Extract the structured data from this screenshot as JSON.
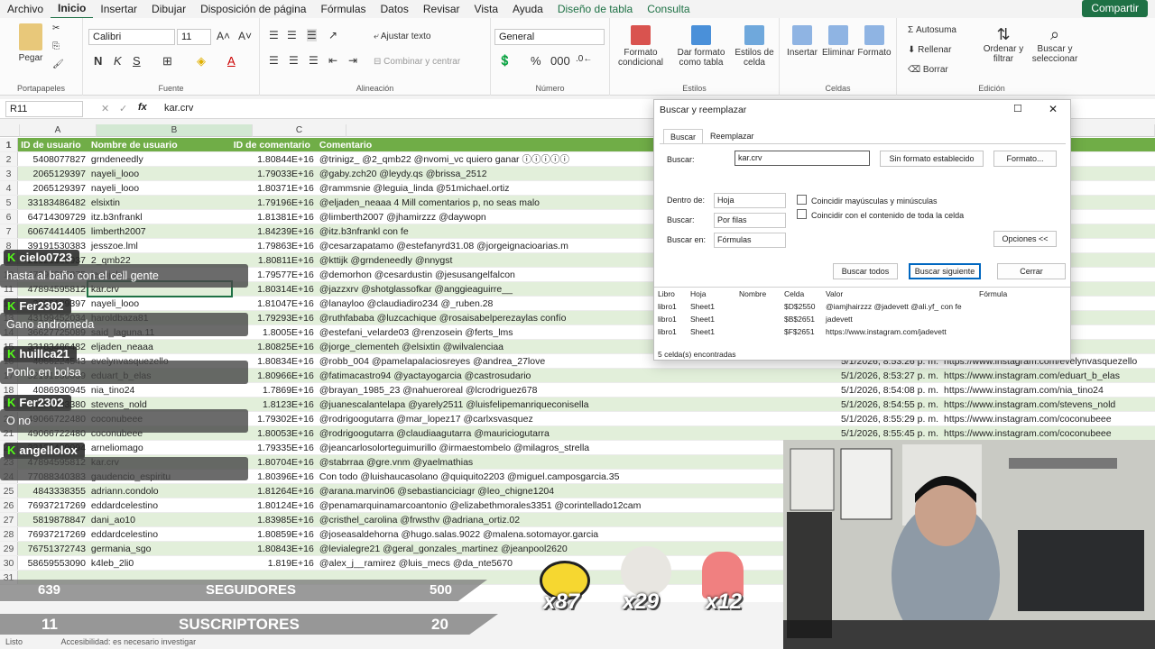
{
  "menu": {
    "tabs": [
      "Archivo",
      "Inicio",
      "Insertar",
      "Dibujar",
      "Disposición de página",
      "Fórmulas",
      "Datos",
      "Revisar",
      "Vista",
      "Ayuda",
      "Diseño de tabla",
      "Consulta"
    ],
    "share": "Compartir"
  },
  "ribbon": {
    "paste": "Pegar",
    "clipboard": "Portapapeles",
    "font_name": "Calibri",
    "font_size": "11",
    "font_group": "Fuente",
    "wrap": "Ajustar texto",
    "merge": "Combinar y centrar",
    "align_group": "Alineación",
    "number_format": "General",
    "number_group": "Número",
    "cond_format": "Formato condicional",
    "table_format": "Dar formato como tabla",
    "cell_styles": "Estilos de celda",
    "styles_group": "Estilos",
    "insert": "Insertar",
    "delete": "Eliminar",
    "format": "Formato",
    "cells_group": "Celdas",
    "autosum": "Autosuma",
    "fill": "Rellenar",
    "clear": "Borrar",
    "sort": "Ordenar y filtrar",
    "find": "Buscar y seleccionar",
    "edit_group": "Edición"
  },
  "formula_bar": {
    "cell_ref": "R11",
    "fx": "fx",
    "value": "kar.crv"
  },
  "columns": [
    "A",
    "B",
    "C",
    "D"
  ],
  "table": {
    "headers": [
      "ID de usuario",
      "Nombre de usuario",
      "ID de comentario",
      "Comentario"
    ],
    "rows": [
      {
        "n": "2",
        "a": "5408077827",
        "b": "grndeneedly",
        "c": "1.80844E+16",
        "d": "@trinigz_ @2_qmb22 @nvomi_vc quiero ganar ⓘⓘⓘⓘⓘ",
        "e": "",
        "f": "eedly"
      },
      {
        "n": "3",
        "a": "2065129397",
        "b": "nayeli_looo",
        "c": "1.79033E+16",
        "d": "@gaby.zch20 @leydy.qs @brissa_2512",
        "e": "",
        "f": ""
      },
      {
        "n": "4",
        "a": "2065129397",
        "b": "nayeli_looo",
        "c": "1.80371E+16",
        "d": "@rammsnie @leguia_linda @51michael.ortiz",
        "e": "",
        "f": ""
      },
      {
        "n": "5",
        "a": "33183486482",
        "b": "elsixtin",
        "c": "1.79196E+16",
        "d": "@eljaden_neaaa 4 Mill comentarios p, no seas malo",
        "e": "",
        "f": ""
      },
      {
        "n": "6",
        "a": "64714309729",
        "b": "itz.b3nfrankl",
        "c": "1.81381E+16",
        "d": "@limberth2007 @jhamirzzz @daywopn",
        "e": "",
        "f": "frankl"
      },
      {
        "n": "7",
        "a": "60674414405",
        "b": "limberth2007",
        "c": "1.84239E+16",
        "d": "@itz.b3nfrankl con fe",
        "e": "",
        "f": "th2007"
      },
      {
        "n": "8",
        "a": "39191530383",
        "b": "jesszoe.lml",
        "c": "1.79863E+16",
        "d": "@cesarzapatamo @estefanyrd31.08 @jorgeignacioarias.m",
        "e": "",
        "f": "e.lml"
      },
      {
        "n": "9",
        "a": "26121339937",
        "b": "2_qmb22",
        "c": "1.80811E+16",
        "d": "@kttijk @grndeneedly @nnygst",
        "e": "",
        "f": ""
      },
      {
        "n": "10",
        "a": "47895395875",
        "b": "jesujohn_",
        "c": "1.79577E+16",
        "d": "@demorhon @cesardustin @jesusangelfalcon",
        "e": "",
        "f": "cham15"
      },
      {
        "n": "11",
        "a": "47894595812",
        "b": "kar.crv",
        "c": "1.80314E+16",
        "d": "@jazzxrv @shotglassofkar @anggieaguirre__",
        "e": "",
        "f": ""
      },
      {
        "n": "12",
        "a": "2065129397",
        "b": "nayeli_looo",
        "c": "1.81047E+16",
        "d": "@lanayloo @claudiadiro234 @_ruben.28",
        "e": "",
        "f": "_looo"
      },
      {
        "n": "13",
        "a": "43199452034",
        "b": "haroldbaza81",
        "c": "1.79293E+16",
        "d": "@ruthfababa @luzcachique @rosaisabelperezaylas confío",
        "e": "",
        "f": "baza81"
      },
      {
        "n": "14",
        "a": "36627725089",
        "b": "said_laguna.11",
        "c": "1.8005E+16",
        "d": "@estefani_velarde03 @renzosein @ferts_lms",
        "e": "",
        "f": "guna.11"
      },
      {
        "n": "15",
        "a": "33183486482",
        "b": "eljaden_neaaa",
        "c": "1.80825E+16",
        "d": "@jorge_clementeh @elsixtin @wilvalenciaa",
        "e": "",
        "f": "n_neaaa"
      },
      {
        "n": "16",
        "a": "4066224543",
        "b": "evelynvasquezello",
        "c": "1.80834E+16",
        "d": "@robb_004 @pamelapalaciosreyes @andrea_27love",
        "e": "5/1/2026, 8:53:26 p. m.",
        "f": "https://www.instagram.com/evelynvasquezello"
      },
      {
        "n": "17",
        "a": "52191930039",
        "b": "eduart_b_elas",
        "c": "1.80966E+16",
        "d": "@fatimacastro94 @yactayogarcia @castrosudario",
        "e": "5/1/2026, 8:53:27 p. m.",
        "f": "https://www.instagram.com/eduart_b_elas"
      },
      {
        "n": "18",
        "a": "4086930945",
        "b": "nia_tino24",
        "c": "1.7869E+16",
        "d": "@brayan_1985_23 @nahueroreal @lcrodriguez678",
        "e": "5/1/2026, 8:54:08 p. m.",
        "f": "https://www.instagram.com/nia_tino24"
      },
      {
        "n": "19",
        "a": "4286983380",
        "b": "stevens_nold",
        "c": "1.8123E+16",
        "d": "@juanescalantelapa @yarely2511 @luisfelipemanriqueconisella",
        "e": "5/1/2026, 8:54:55 p. m.",
        "f": "https://www.instagram.com/stevens_nold"
      },
      {
        "n": "20",
        "a": "49066722480",
        "b": "coconubeee",
        "c": "1.79302E+16",
        "d": "@rodrigoogutarra @mar_lopez17 @carlxsvasquez",
        "e": "5/1/2026, 8:55:29 p. m.",
        "f": "https://www.instagram.com/coconubeee"
      },
      {
        "n": "21",
        "a": "49066722480",
        "b": "coconubeee",
        "c": "1.80053E+16",
        "d": "@rodrigoogutarra @claudiaagutarra @mauriciogutarra",
        "e": "5/1/2026, 8:55:45 p. m.",
        "f": "https://www.instagram.com/coconubeee"
      },
      {
        "n": "22",
        "a": "33123430094",
        "b": "arneliomago",
        "c": "1.79335E+16",
        "d": "@jeancarlosolorteguimurillo @irmaestombelo @milagros_strella",
        "e": "",
        "f": ""
      },
      {
        "n": "23",
        "a": "47894595812",
        "b": "kar.crv",
        "c": "1.80704E+16",
        "d": "@stabrraa @gre.vnm @yaelmathias",
        "e": "",
        "f": ""
      },
      {
        "n": "24",
        "a": "77088340383",
        "b": "gaudencio_espiritu",
        "c": "1.80396E+16",
        "d": "Con todo @luishaucasolano @quiquito2203 @miguel.camposgarcia.35",
        "e": "",
        "f": ""
      },
      {
        "n": "25",
        "a": "4843338355",
        "b": "adriann.condolo",
        "c": "1.81264E+16",
        "d": "@arana.marvin06 @sebastianciciagr @leo_chigne1204",
        "e": "",
        "f": ""
      },
      {
        "n": "26",
        "a": "76937217269",
        "b": "eddardcelestino",
        "c": "1.80124E+16",
        "d": "@penamarquinamarcoantonio @elizabethmorales3351 @corintellado12cam",
        "e": "",
        "f": ""
      },
      {
        "n": "27",
        "a": "5819878847",
        "b": "dani_ao10",
        "c": "1.83985E+16",
        "d": "@cristhel_carolina @frwsthv @adriana_ortiz.02",
        "e": "",
        "f": ""
      },
      {
        "n": "28",
        "a": "76937217269",
        "b": "eddardcelestino",
        "c": "1.80859E+16",
        "d": "@joseasaldehorna @hugo.salas.9022 @malena.sotomayor.garcia",
        "e": "",
        "f": ""
      },
      {
        "n": "29",
        "a": "76751372743",
        "b": "germania_sgo",
        "c": "1.80843E+16",
        "d": "@levialegre21 @geral_gonzales_martinez @jeanpool2620",
        "e": "",
        "f": ""
      },
      {
        "n": "30",
        "a": "58659553090",
        "b": "k4leb_2li0",
        "c": "1.819E+16",
        "d": "@alex_j__ramirez @luis_mecs @da_nte5670",
        "e": "",
        "f": ""
      },
      {
        "n": "31",
        "a": "",
        "b": "",
        "c": "",
        "d": "",
        "e": "",
        "f": ""
      }
    ]
  },
  "dialog": {
    "title": "Buscar y reemplazar",
    "tab_find": "Buscar",
    "tab_replace": "Reemplazar",
    "find_label": "Buscar:",
    "find_value": "kar.crv",
    "no_format": "Sin formato establecido",
    "format_btn": "Formato...",
    "within_label": "Dentro de:",
    "within_value": "Hoja",
    "search_label": "Buscar:",
    "search_value": "Por filas",
    "look_label": "Buscar en:",
    "look_value": "Fórmulas",
    "match_case": "Coincidir mayúsculas y minúsculas",
    "match_entire": "Coincidir con el contenido de toda la celda",
    "options": "Opciones <<",
    "find_all": "Buscar todos",
    "find_next": "Buscar siguiente",
    "close": "Cerrar",
    "result_headers": [
      "Libro",
      "Hoja",
      "Nombre",
      "Celda",
      "Valor",
      "Fórmula"
    ],
    "results": [
      {
        "libro": "libro1",
        "hoja": "Sheet1",
        "nombre": "",
        "celda": "$D$2550",
        "valor": "@iamjhairzzz @jadevett @ali.yf_ con fe"
      },
      {
        "libro": "libro1",
        "hoja": "Sheet1",
        "nombre": "",
        "celda": "$B$2651",
        "valor": "jadevett"
      },
      {
        "libro": "libro1",
        "hoja": "Sheet1",
        "nombre": "",
        "celda": "$F$2651",
        "valor": "https://www.instagram.com/jadevett"
      }
    ],
    "found_count": "5 celda(s) encontradas"
  },
  "chat": [
    {
      "user": "cielo0723",
      "text": "hasta al baño con el cell gente"
    },
    {
      "user": "Fer2302",
      "text": "Gano andromeda"
    },
    {
      "user": "huillca21",
      "text": "Ponlo en bolsa"
    },
    {
      "user": "Fer2302",
      "text": "O no"
    },
    {
      "user": "angellolox",
      "text": ""
    }
  ],
  "stats": {
    "followers_current": "639",
    "followers_label": "SEGUIDORES",
    "followers_goal": "500",
    "subs_current": "11",
    "subs_label": "SUSCRIPTORES",
    "subs_goal": "20"
  },
  "emotes": [
    {
      "name": "bee-emote",
      "count": "x87"
    },
    {
      "name": "cat-emote",
      "count": "x29"
    },
    {
      "name": "clap-emote",
      "count": "x12"
    }
  ],
  "status_bar": {
    "ready": "Listo",
    "accessibility": "Accesibilidad: es necesario investigar"
  },
  "colors": {
    "excel_green": "#1e7145",
    "table_header": "#70ad47",
    "table_alt": "#e2efda",
    "kick_green": "#53fc18"
  }
}
